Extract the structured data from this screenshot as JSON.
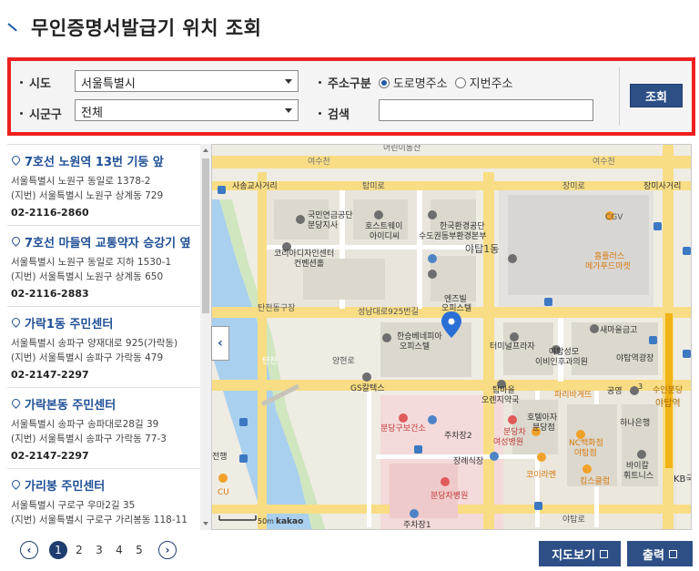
{
  "page": {
    "title": "무인증명서발급기 위치 조회"
  },
  "search": {
    "sido_label": "시도",
    "sido_value": "서울특별시",
    "sigungu_label": "시군구",
    "sigungu_value": "전체",
    "addr_type_label": "주소구분",
    "addr_type_option1": "도로명주소",
    "addr_type_option2": "지번주소",
    "keyword_label": "검색",
    "keyword_value": "",
    "search_button": "조회"
  },
  "list": [
    {
      "name": "7호선 노원역 13번 기둥 앞",
      "road": "서울특별시 노원구 동일로 1378-2",
      "jibun": "(지번) 서울특별시 노원구 상계동 729",
      "tel": "02-2116-2860"
    },
    {
      "name": "7호선 마들역 교통약자 승강기 옆",
      "road": "서울특별시 노원구 동일로 지하 1530-1",
      "jibun": "(지번) 서울특별시 노원구 상계동 650",
      "tel": "02-2116-2883"
    },
    {
      "name": "가락1동 주민센터",
      "road": "서울특별시 송파구 양재대로 925(가락동)",
      "jibun": "(지번) 서울특별시 송파구 가락동 479",
      "tel": "02-2147-2297"
    },
    {
      "name": "가락본동 주민센터",
      "road": "서울특별시 송파구 송파대로28길 39",
      "jibun": "(지번) 서울특별시 송파구 가락동 77-3",
      "tel": "02-2147-2297"
    },
    {
      "name": "가리봉 주민센터",
      "road": "서울특별시 구로구 우마2길 35",
      "jibun": "(지번) 서울특별시 구로구 가리봉동 118-11",
      "tel": ""
    }
  ],
  "map": {
    "labels": {
      "yeosu1": "여수천",
      "yeosu2": "여수천",
      "top_cut": "어린이동산",
      "sasang": "사송교사거리",
      "tammi": "탑미로",
      "tammi2": "장미로",
      "jangmi": "장미사거리",
      "nps": "국민연금공단",
      "nps2": "분당지사",
      "host": "호스트웨이",
      "host2": "아이디씨",
      "env": "한국환경공단",
      "env2": "수도권동부환경본부",
      "cgv": "CGV",
      "korea_id": "코리아디자인센터",
      "korea_id2": "컨벤션홀",
      "yatap": "야탑1동",
      "homeplus": "홈플러스",
      "homeplus2": "메가푸드마켓",
      "tancheon": "탄천동구장",
      "seongnam": "성남대로925번길",
      "entel": "엔즈빌",
      "entel2": "오피스텔",
      "hanseung": "한승베네피아",
      "hanseung2": "오피스텔",
      "terminal": "터미널프라자",
      "saemaeul": "새마을금고",
      "yatapsm": "야탑성모",
      "yatapsm2": "이비인후과의원",
      "yatap_sq": "야탑역광장",
      "gs": "GS칼텍스",
      "tammaeul": "탑마을",
      "tammaeul2": "오렌지약국",
      "paris": "파리바게뜨",
      "park": "공영",
      "hospital_bd": "분당구보건소",
      "parking2": "주차장2",
      "bundangcha": "분당차",
      "bundangcha2": "여성병원",
      "hotel": "호텔아자",
      "hotel2": "분당점",
      "nc": "NC백화점",
      "nc2": "야탑점",
      "hana": "하나은행",
      "jangrye": "장례식장",
      "korea_ramen": "코이라멘",
      "kims": "킴스클럽",
      "baikal": "바이칼",
      "baikal2": "휘트니스",
      "bundangcha_hosp": "분당차병원",
      "parking1": "주차장1",
      "yatapro": "야탑로",
      "yatap_station": "야탑역",
      "suin": "수인분당",
      "kb": "KB국",
      "cu": "CU",
      "jeonhaeng": "전행",
      "scale": "50m",
      "kakao": "kakao",
      "tancheon_river": "탄천",
      "yangcheon": "양현로",
      "line_no": "3",
      "tammaro_v": "탑미로"
    }
  },
  "pager": {
    "prev": "‹",
    "next": "›",
    "pages": [
      "1",
      "2",
      "3",
      "4",
      "5"
    ],
    "current": "1"
  },
  "buttons": {
    "map_view": "지도보기",
    "print": "출력"
  }
}
